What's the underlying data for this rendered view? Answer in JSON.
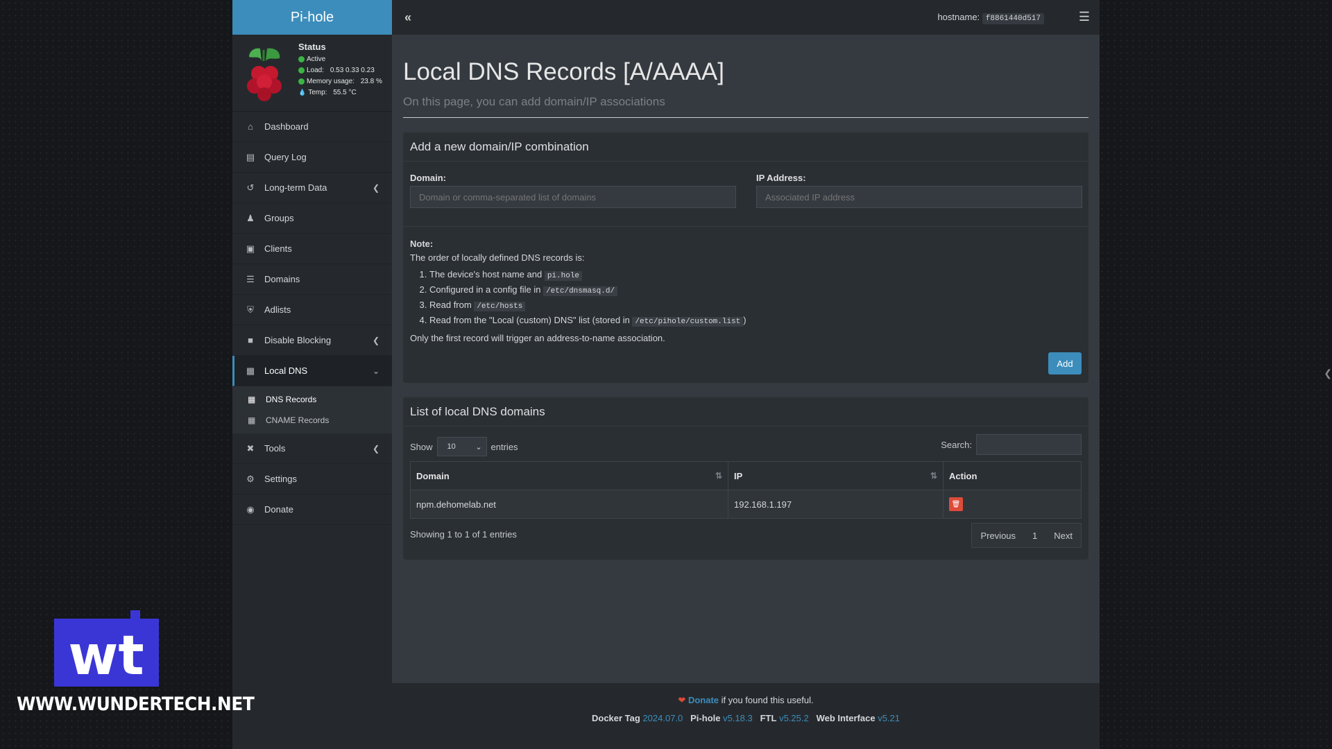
{
  "brand": "Pi-hole",
  "status": {
    "title": "Status",
    "active": "Active",
    "load_label": "Load:",
    "load_values": "0.53  0.33  0.23",
    "memory_label": "Memory usage:",
    "memory_value": "23.8 %",
    "temp_label": "Temp:",
    "temp_value": "55.5 °C"
  },
  "nav": {
    "dashboard": "Dashboard",
    "query_log": "Query Log",
    "long_term": "Long-term Data",
    "groups": "Groups",
    "clients": "Clients",
    "domains": "Domains",
    "adlists": "Adlists",
    "disable_blocking": "Disable Blocking",
    "local_dns": "Local DNS",
    "dns_records": "DNS Records",
    "cname_records": "CNAME Records",
    "tools": "Tools",
    "settings": "Settings",
    "donate": "Donate"
  },
  "topbar": {
    "hostname_label": "hostname:",
    "hostname_value": "f8861440d517"
  },
  "page": {
    "title": "Local DNS Records [A/AAAA]",
    "subtitle": "On this page, you can add domain/IP associations"
  },
  "add_box": {
    "title": "Add a new domain/IP combination",
    "domain_label": "Domain:",
    "domain_placeholder": "Domain or comma-separated list of domains",
    "ip_label": "IP Address:",
    "ip_placeholder": "Associated IP address",
    "note_title": "Note:",
    "note_intro": "The order of locally defined DNS records is:",
    "item1_text": "The device's host name and",
    "item1_code": "pi.hole",
    "item2_text": "Configured in a config file in",
    "item2_code": "/etc/dnsmasq.d/",
    "item3_text": "Read from",
    "item3_code": "/etc/hosts",
    "item4_text": "Read from the \"Local (custom) DNS\" list (stored in",
    "item4_code": "/etc/pihole/custom.list",
    "item4_end": ")",
    "note_end": "Only the first record will trigger an address-to-name association.",
    "add_button": "Add"
  },
  "list_box": {
    "title": "List of local DNS domains",
    "show_label": "Show",
    "show_value": "10",
    "entries_label": "entries",
    "search_label": "Search:",
    "columns": [
      "Domain",
      "IP",
      "Action"
    ],
    "rows": [
      {
        "domain": "npm.dehomelab.net",
        "ip": "192.168.1.197"
      }
    ],
    "showing": "Showing 1 to 1 of 1 entries",
    "prev": "Previous",
    "page": "1",
    "next": "Next"
  },
  "footer": {
    "donate_link": "Donate",
    "donate_text": " if you found this useful.",
    "docker_label": "Docker Tag",
    "docker_value": "2024.07.0",
    "pihole_label": "Pi-hole",
    "pihole_value": "v5.18.3",
    "ftl_label": "FTL",
    "ftl_value": "v5.25.2",
    "web_label": "Web Interface",
    "web_value": "v5.21"
  },
  "watermark": {
    "text": "WWW.WUNDERTECH.NET",
    "logo_text": "wt"
  },
  "colors": {
    "accent": "#3c8dbc",
    "danger": "#dd4b39",
    "active_dot": "#3bb543"
  }
}
